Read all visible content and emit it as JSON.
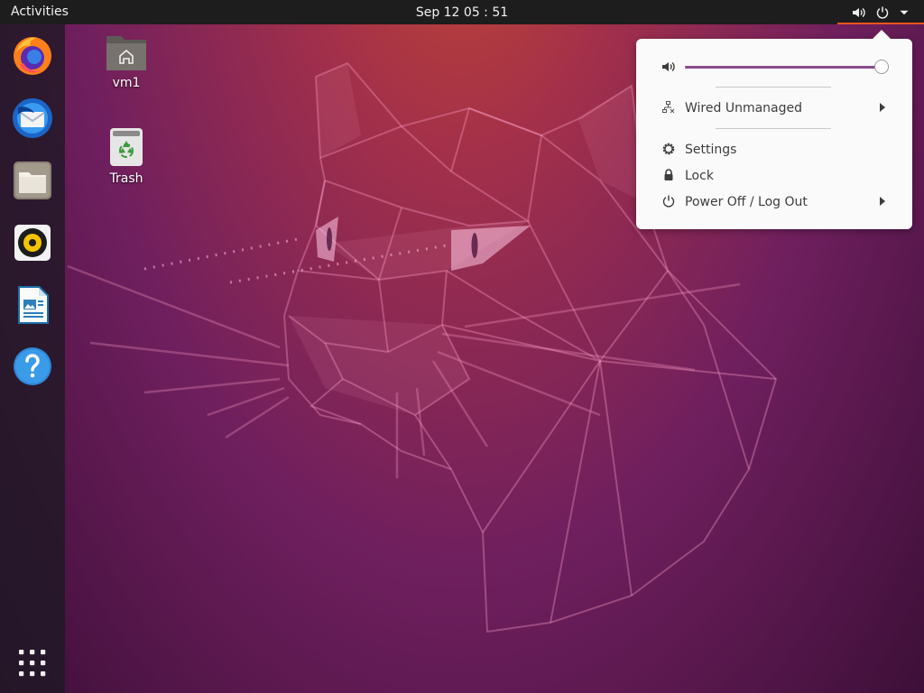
{
  "topbar": {
    "activities_label": "Activities",
    "clock": "Sep 12  05 : 51"
  },
  "system_indicators": [
    "volume-icon",
    "power-icon",
    "dropdown-arrow-icon"
  ],
  "dock": {
    "items": [
      {
        "name": "Firefox Web Browser",
        "icon": "firefox-icon"
      },
      {
        "name": "Thunderbird Mail",
        "icon": "thunderbird-icon"
      },
      {
        "name": "Files",
        "icon": "files-icon"
      },
      {
        "name": "Rhythmbox",
        "icon": "rhythmbox-icon"
      },
      {
        "name": "LibreOffice Writer",
        "icon": "libreoffice-writer-icon"
      },
      {
        "name": "Help",
        "icon": "help-icon"
      }
    ],
    "show_apps_icon": "show-applications-icon"
  },
  "desktop": {
    "icons": [
      {
        "label": "vm1",
        "icon": "home-folder-icon"
      },
      {
        "label": "Trash",
        "icon": "trash-icon"
      }
    ]
  },
  "system_menu": {
    "volume_level": 1.0,
    "items": [
      {
        "label": "Wired Unmanaged",
        "icon": "wired-network-icon",
        "submenu": true
      },
      {
        "label": "Settings",
        "icon": "settings-gear-icon",
        "submenu": false
      },
      {
        "label": "Lock",
        "icon": "lock-icon",
        "submenu": false
      },
      {
        "label": "Power Off / Log Out",
        "icon": "power-icon",
        "submenu": true
      }
    ]
  },
  "colors": {
    "topbar": "#1d1d1d",
    "accent": "#e95420",
    "slider_fill": "#8b4a8b",
    "menu_bg": "#fafafa"
  }
}
